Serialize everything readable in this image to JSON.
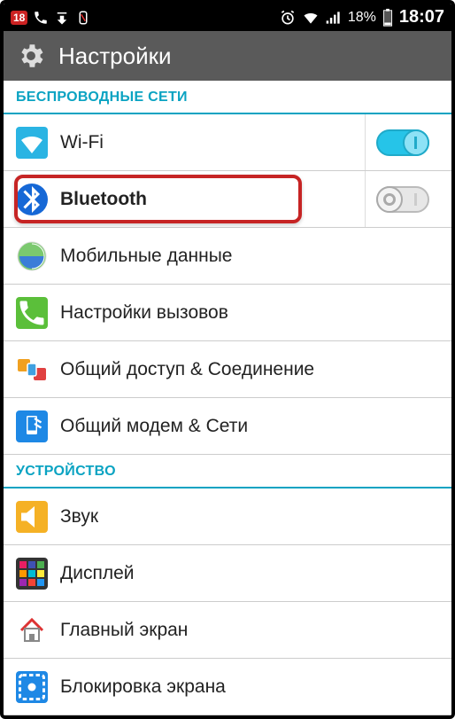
{
  "statusbar": {
    "badge": "18",
    "battery_pct": "18%",
    "time": "18:07"
  },
  "title": "Настройки",
  "sections": {
    "wireless": "БЕСПРОВОДНЫЕ СЕТИ",
    "device": "УСТРОЙСТВО"
  },
  "rows": {
    "wifi": {
      "label": "Wi-Fi",
      "toggle": "on"
    },
    "bluetooth": {
      "label": "Bluetooth",
      "toggle": "off"
    },
    "mobiledata": {
      "label": "Мобильные данные"
    },
    "call": {
      "label": "Настройки вызовов"
    },
    "share": {
      "label": "Общий доступ & Соединение"
    },
    "tether": {
      "label": "Общий модем & Сети"
    },
    "sound": {
      "label": "Звук"
    },
    "display": {
      "label": "Дисплей"
    },
    "home": {
      "label": "Главный экран"
    },
    "lock": {
      "label": "Блокировка экрана"
    }
  }
}
